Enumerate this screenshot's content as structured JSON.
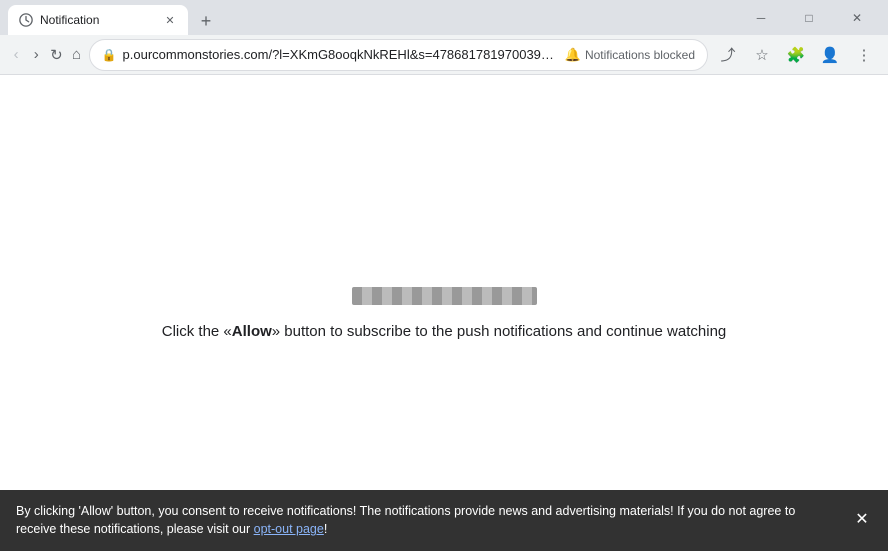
{
  "window": {
    "title": "Notification",
    "controls": {
      "minimize": "─",
      "maximize": "□",
      "close": "✕"
    }
  },
  "tab": {
    "favicon_label": "notification-favicon",
    "title": "Notification",
    "close_label": "✕",
    "new_tab_label": "+"
  },
  "toolbar": {
    "back_label": "‹",
    "forward_label": "›",
    "refresh_label": "↻",
    "home_label": "⌂",
    "url": "p.ourcommonstories.com/?l=XKmG8ooqkNkREHl&s=478681781970039735&z=4...",
    "lock_icon": "🔒",
    "notification_blocked_label": "Notifications blocked",
    "notification_icon": "🔔",
    "share_label": "⬆",
    "bookmark_label": "☆",
    "extensions_label": "🧩",
    "profile_label": "👤",
    "menu_label": "⋮"
  },
  "main": {
    "message": "Click the «Allow» button to subscribe to the push notifications and continue watching",
    "allow_word": "Allow"
  },
  "banner": {
    "text_before": "By clicking 'Allow' button, you consent to receive notifications! The notifications provide news and advertising materials! If you do not agree to receive these notifications, please visit our ",
    "link_text": "opt-out page",
    "text_after": "!",
    "close_label": "✕"
  }
}
